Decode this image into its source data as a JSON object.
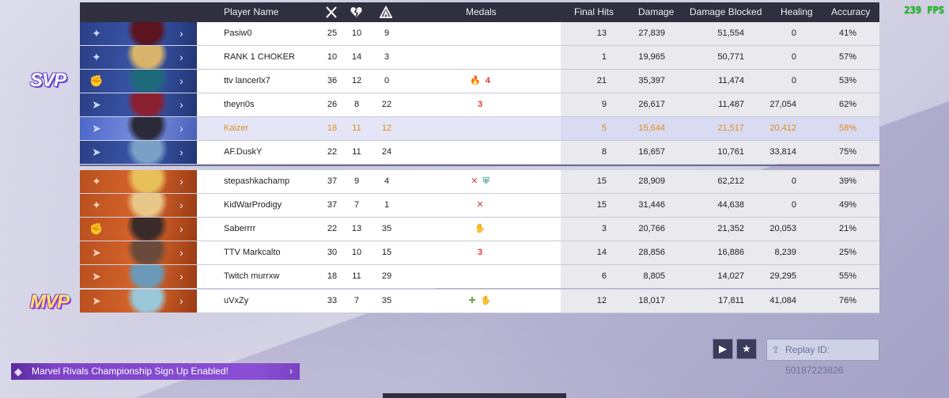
{
  "fps": "239 FPS",
  "header": {
    "player_name": "Player Name",
    "kills_icon": "crossed-swords-icon",
    "deaths_icon": "broken-heart-icon",
    "assists_icon": "assist-hands-icon",
    "medals": "Medals",
    "final_hits": "Final Hits",
    "damage": "Damage",
    "damage_blocked": "Damage Blocked",
    "healing": "Healing",
    "accuracy": "Accuracy"
  },
  "badges": {
    "svp": "SVP",
    "mvp": "MVP"
  },
  "team_blue": [
    {
      "name": "Pasiw0",
      "k": "25",
      "d": "10",
      "a": "9",
      "medals": [],
      "final_hits": "13",
      "damage": "27,839",
      "blocked": "51,554",
      "healing": "0",
      "accuracy": "41%",
      "role": "vanguard",
      "hero_color": "#5b1420"
    },
    {
      "name": "RANK 1 CHOKER",
      "k": "10",
      "d": "14",
      "a": "3",
      "medals": [],
      "final_hits": "1",
      "damage": "19,965",
      "blocked": "50,771",
      "healing": "0",
      "accuracy": "57%",
      "role": "vanguard",
      "hero_color": "#d8b46a"
    },
    {
      "name": "ttv lancerlx7",
      "k": "36",
      "d": "12",
      "a": "0",
      "medals": [
        {
          "t": "🔥",
          "c": "orange"
        },
        {
          "t": "4",
          "c": "red"
        }
      ],
      "final_hits": "21",
      "damage": "35,397",
      "blocked": "11,474",
      "healing": "0",
      "accuracy": "53%",
      "role": "duelist",
      "hero_color": "#1e6a7a"
    },
    {
      "name": "theyn0s",
      "k": "26",
      "d": "8",
      "a": "22",
      "medals": [
        {
          "t": "3",
          "c": "red"
        }
      ],
      "final_hits": "9",
      "damage": "26,617",
      "blocked": "11,487",
      "healing": "27,054",
      "accuracy": "62%",
      "role": "strategist",
      "hero_color": "#8a2030"
    },
    {
      "name": "Kaizer",
      "k": "18",
      "d": "11",
      "a": "12",
      "medals": [],
      "final_hits": "5",
      "damage": "15,644",
      "blocked": "21,517",
      "healing": "20,412",
      "accuracy": "58%",
      "role": "strategist",
      "hero_color": "#2a2a38",
      "me": true
    },
    {
      "name": "AF.DuskY",
      "k": "22",
      "d": "11",
      "a": "24",
      "medals": [],
      "final_hits": "8",
      "damage": "16,657",
      "blocked": "10,761",
      "healing": "33,814",
      "accuracy": "75%",
      "role": "strategist",
      "hero_color": "#7aa0c8"
    }
  ],
  "team_red": [
    {
      "name": "stepashkachamp",
      "k": "37",
      "d": "9",
      "a": "4",
      "medals": [
        {
          "t": "✕",
          "c": "red"
        },
        {
          "t": "⛨",
          "c": "teal"
        }
      ],
      "final_hits": "15",
      "damage": "28,909",
      "blocked": "62,212",
      "healing": "0",
      "accuracy": "39%",
      "role": "vanguard",
      "hero_color": "#e8c05a"
    },
    {
      "name": "KidWarProdigy",
      "k": "37",
      "d": "7",
      "a": "1",
      "medals": [
        {
          "t": "✕",
          "c": "red"
        }
      ],
      "final_hits": "15",
      "damage": "31,446",
      "blocked": "44,638",
      "healing": "0",
      "accuracy": "49%",
      "role": "vanguard",
      "hero_color": "#e8c888"
    },
    {
      "name": "Saberrrr",
      "k": "22",
      "d": "13",
      "a": "35",
      "medals": [
        {
          "t": "✋",
          "c": "green"
        }
      ],
      "final_hits": "3",
      "damage": "20,766",
      "blocked": "21,352",
      "healing": "20,053",
      "accuracy": "21%",
      "role": "duelist",
      "hero_color": "#3a2a2a"
    },
    {
      "name": "TTV Markcalto",
      "k": "30",
      "d": "10",
      "a": "15",
      "medals": [
        {
          "t": "3",
          "c": "red"
        }
      ],
      "final_hits": "14",
      "damage": "28,856",
      "blocked": "16,886",
      "healing": "8,239",
      "accuracy": "25%",
      "role": "strategist",
      "hero_color": "#6a4a3a"
    },
    {
      "name": "Twitch murrxw",
      "k": "18",
      "d": "11",
      "a": "29",
      "medals": [],
      "final_hits": "6",
      "damage": "8,805",
      "blocked": "14,027",
      "healing": "29,295",
      "accuracy": "55%",
      "role": "strategist",
      "hero_color": "#6a9ab8"
    },
    {
      "name": "uVxZy",
      "k": "33",
      "d": "7",
      "a": "35",
      "medals": [
        {
          "t": "✚",
          "c": "green"
        },
        {
          "t": "✋",
          "c": "green"
        }
      ],
      "final_hits": "12",
      "damage": "18,017",
      "blocked": "17,811",
      "healing": "41,084",
      "accuracy": "76%",
      "role": "strategist",
      "hero_color": "#9ac8d8"
    }
  ],
  "controls": {
    "play_icon": "play-icon",
    "star_icon": "star-icon",
    "share_icon": "share-icon",
    "replay_label": "Replay ID: 50187223826"
  },
  "banner": {
    "text": "Marvel Rivals Championship Sign Up Enabled!",
    "icon": "marvel-rivals-logo-icon"
  }
}
